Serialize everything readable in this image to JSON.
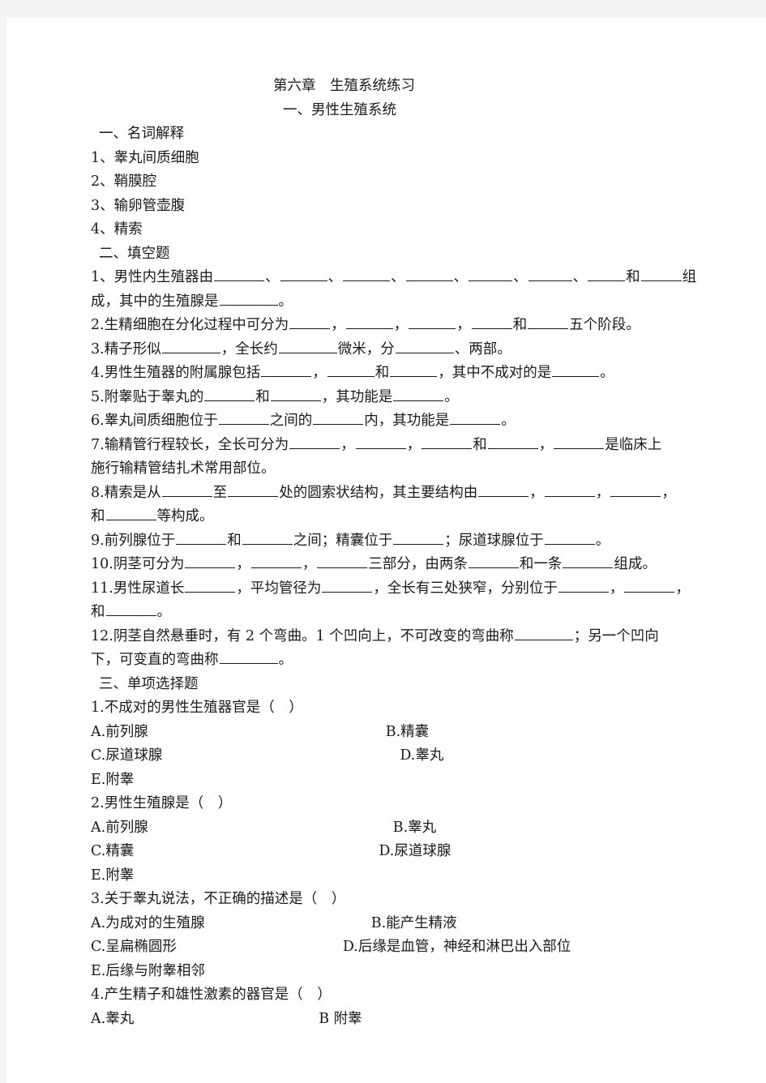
{
  "document": {
    "title_main": "第六章　生殖系统练习",
    "title_sub": "一、男性生殖系统"
  },
  "section_terms": {
    "heading": "一、名词解释",
    "items": [
      "1、睾丸间质细胞",
      "2、鞘膜腔",
      "3、输卵管壶腹",
      "4、精索"
    ]
  },
  "section_fill": {
    "heading": "二、填空题",
    "q1_a": "1、男性内生殖器由",
    "q1_sep": "、",
    "q1_and": "和",
    "q1_b": "组",
    "q1_c": "成，其中的生殖腺是",
    "q1_d": "。",
    "q2_a": "2.生精细胞在分化过程中可分为",
    "q2_sep": "，",
    "q2_and": "和",
    "q2_b": "五个阶段。",
    "q3_a": "3.精子形似",
    "q3_b": "，全长约",
    "q3_c": "微米，分",
    "q3_d": "、两部。",
    "q4_a": "4.男性生殖器的附属腺包括",
    "q4_b": "，",
    "q4_c": "和",
    "q4_d": "，其中不成对的是",
    "q4_e": "。",
    "q5_a": "5.附睾贴于睾丸的",
    "q5_b": "和",
    "q5_c": "，其功能是",
    "q5_d": "。",
    "q6_a": "6.睾丸间质细胞位于",
    "q6_b": "之间的",
    "q6_c": "内，其功能是",
    "q6_d": "。",
    "q7_a": "7.输精管行程较长，全长可分为",
    "q7_b": "，",
    "q7_c": "，",
    "q7_d": "和",
    "q7_e": "，",
    "q7_f": "是临床上",
    "q7_g": "施行输精管结扎术常用部位。",
    "q8_a": "8.精索是从",
    "q8_b": "至",
    "q8_c": "处的圆索状结构，其主要结构由",
    "q8_d": "，",
    "q8_e": "，",
    "q8_f": "，",
    "q8_g": "和",
    "q8_h": "等构成。",
    "q9_a": "9.前列腺位于",
    "q9_b": "和",
    "q9_c": "之间；精囊位于",
    "q9_d": "；尿道球腺位于",
    "q9_e": "。",
    "q10_a": "10.阴茎可分为",
    "q10_b": "，",
    "q10_c": "，",
    "q10_d": "三部分，由两条",
    "q10_e": "和一条",
    "q10_f": "组成。",
    "q11_a": "11.男性尿道长",
    "q11_b": "，平均管径为",
    "q11_c": "，全长有三处狭窄，分别位于",
    "q11_d": "，",
    "q11_e": "，",
    "q11_f": "和",
    "q11_g": "。",
    "q12_a": "12.阴茎自然悬垂时，有 2 个弯曲。1 个凹向上，不可改变的弯曲称",
    "q12_b": "；另一个凹向",
    "q12_c": "下，可变直的弯曲称",
    "q12_d": "。"
  },
  "section_choice": {
    "heading": "三、单项选择题",
    "questions": [
      {
        "stem": "1.不成对的男性生殖器官是（　）",
        "a": "A.前列腺",
        "b": "B.精囊",
        "c": "C.尿道球腺",
        "d": "D.睾丸",
        "e": "E.附睾"
      },
      {
        "stem": "2.男性生殖腺是（　）",
        "a": "A.前列腺",
        "b": "B.睾丸",
        "c": "C.精囊",
        "d": "D.尿道球腺",
        "e": "E.附睾"
      },
      {
        "stem": "3.关于睾丸说法，不正确的描述是（　）",
        "a": "A.为成对的生殖腺",
        "b": "B.能产生精液",
        "c": "C.呈扁椭圆形",
        "d": "D.后缘是血管，神经和淋巴出入部位",
        "e": "E.后缘与附睾相邻"
      },
      {
        "stem": "4.产生精子和雄性激素的器官是（　）",
        "a": "A.睾丸",
        "b": "B 附睾",
        "c": "",
        "d": "",
        "e": ""
      }
    ]
  }
}
